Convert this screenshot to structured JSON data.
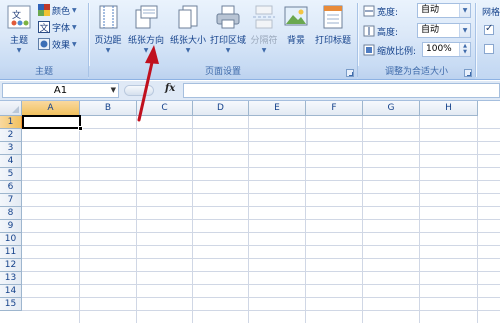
{
  "ribbon": {
    "theme_group": {
      "label": "主题",
      "themes_button": "主题",
      "colors_button": "颜色",
      "fonts_button": "字体",
      "effects_button": "效果"
    },
    "page_setup_group": {
      "label": "页面设置",
      "margins": "页边距",
      "orientation": "纸张方向",
      "size": "纸张大小",
      "print_area": "打印区域",
      "breaks": "分隔符",
      "background": "背景",
      "print_titles": "打印标题"
    },
    "scale_group": {
      "label": "调整为合适大小",
      "width_label": "宽度:",
      "width_value": "自动",
      "height_label": "高度:",
      "height_value": "自动",
      "scale_label": "缩放比例:",
      "scale_value": "100%"
    },
    "sheet_options_group": {
      "gridlines_label": "网格",
      "gridlines_view_checked": true,
      "gridlines_print_checked": false
    }
  },
  "formula_bar": {
    "name_box": "A1",
    "fx": "fx",
    "value": ""
  },
  "grid": {
    "columns": [
      "A",
      "B",
      "C",
      "D",
      "E",
      "F",
      "G",
      "H"
    ],
    "rows": [
      "1",
      "2",
      "3",
      "4",
      "5",
      "6",
      "7",
      "8",
      "9",
      "10",
      "11",
      "12",
      "13",
      "14",
      "15"
    ],
    "selected_cell": "A1"
  },
  "colors": {
    "ribbon_bg": "#dbe8f8",
    "header_selected": "#f1c15f",
    "annotation_arrow": "#c0101e"
  }
}
